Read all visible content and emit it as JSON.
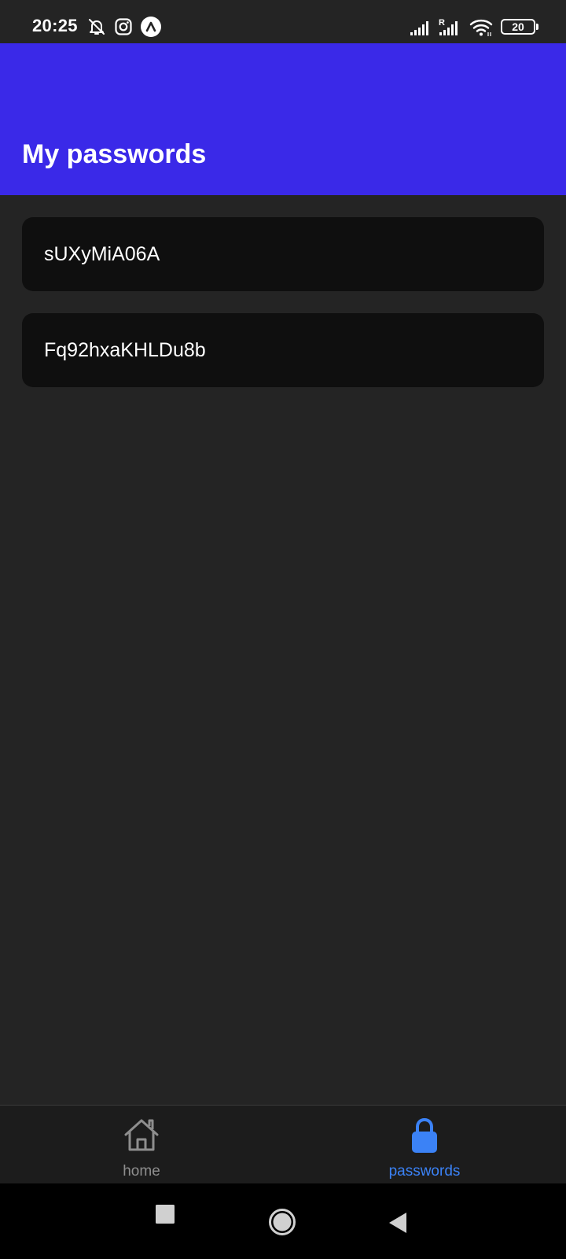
{
  "status_bar": {
    "time": "20:25",
    "icons": [
      "notifications-off-icon",
      "instagram-icon",
      "expo-icon",
      "signal-icon",
      "roaming-signal-icon",
      "wifi-icon"
    ],
    "battery_level": "20",
    "roaming_label": "R"
  },
  "header": {
    "title": "My passwords",
    "background_color": "#3a29e8"
  },
  "passwords": [
    {
      "value": "sUXyMiA06A"
    },
    {
      "value": "Fq92hxaKHLDu8b"
    }
  ],
  "tab_bar": {
    "active_color": "#3b82f6",
    "inactive_color": "#8e8e8e",
    "tabs": [
      {
        "label": "home",
        "icon": "home-icon",
        "active": false
      },
      {
        "label": "passwords",
        "icon": "lock-icon",
        "active": true
      }
    ]
  },
  "system_nav": {
    "buttons": [
      "recent-apps-button",
      "home-button",
      "back-button"
    ]
  }
}
